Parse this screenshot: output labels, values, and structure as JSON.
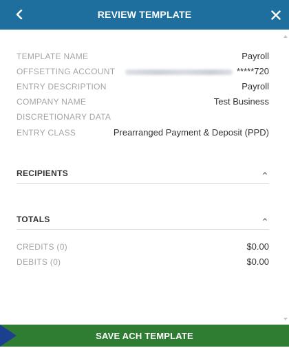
{
  "header": {
    "title": "REVIEW TEMPLATE",
    "back_icon": "chevron-left-icon",
    "close_icon": "close-icon"
  },
  "details": [
    {
      "label": "TEMPLATE NAME",
      "value": "Payroll"
    },
    {
      "label": "OFFSETTING ACCOUNT",
      "value": "*****720",
      "redacted": true
    },
    {
      "label": "ENTRY DESCRIPTION",
      "value": "Payroll"
    },
    {
      "label": "COMPANY NAME",
      "value": "Test Business"
    },
    {
      "label": "DISCRETIONARY DATA",
      "value": ""
    },
    {
      "label": "ENTRY CLASS",
      "value": "Prearranged Payment & Deposit (PPD)"
    }
  ],
  "recipients": {
    "title": "RECIPIENTS",
    "expanded": true
  },
  "totals": {
    "title": "TOTALS",
    "expanded": true,
    "rows": [
      {
        "label": "CREDITS (0)",
        "value": "$0.00"
      },
      {
        "label": "DEBITS (0)",
        "value": "$0.00"
      }
    ]
  },
  "footer": {
    "save_label": "SAVE ACH TEMPLATE"
  },
  "colors": {
    "header_bg": "#1f6f9e",
    "footer_bg": "#2f7d32",
    "pointer": "#1d3f8f",
    "label": "#a5a5a5",
    "value": "#333333"
  }
}
